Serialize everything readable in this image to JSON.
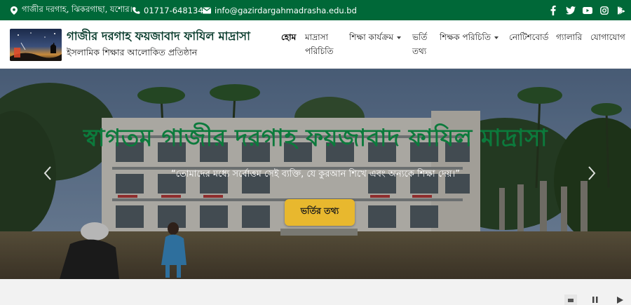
{
  "topbar": {
    "address": "গাজীর দরগাহ, ঝিকরগাছা, যশোর।",
    "phone": "01717-648134",
    "email": "info@gazirdargahmadrasha.edu.bd",
    "social": [
      "facebook-icon",
      "twitter-icon",
      "youtube-icon",
      "instagram-icon",
      "google-play-icon"
    ]
  },
  "header": {
    "title": "গাজীর দরগাহ ফয়জাবাদ ফাযিল মাদ্রাসা",
    "tagline": "ইসলামিক শিক্ষার আলোকিত প্রতিষ্ঠান",
    "nav": {
      "home": "হোম",
      "about_line1": "মাদ্রাসা",
      "about_line2": "পরিচিতি",
      "programs": "শিক্ষা কার্যক্রম",
      "admission_line1": "ভর্তি",
      "admission_line2": "তথ্য",
      "teachers": "শিক্ষক পরিচিতি",
      "notice": "নোটিশবোর্ড",
      "gallery": "গ্যালারি",
      "contact": "যোগাযোগ"
    }
  },
  "hero": {
    "title": "স্বাগতম গাজীর দরগাহ ফয়জাবাদ ফাযিল মাদ্রাসা",
    "quote": "“তোমাদের মধ্যে সর্বোত্তম সেই ব্যক্তি, যে কুরআন শিখে এবং অন্যকে শিক্ষা দেয়।”",
    "button": "ভর্তির তথ্য"
  },
  "colors": {
    "topbar": "#006838",
    "hero_title": "#0c7a3c",
    "button": "#e8b82e"
  }
}
